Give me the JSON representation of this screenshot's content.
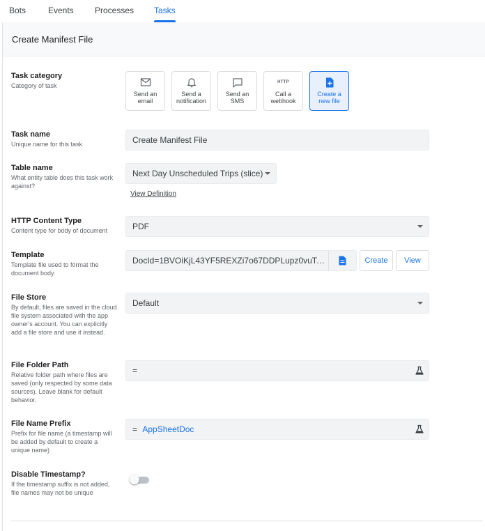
{
  "tabs": [
    {
      "label": "Bots"
    },
    {
      "label": "Events"
    },
    {
      "label": "Processes"
    },
    {
      "label": "Tasks"
    }
  ],
  "panel": {
    "title": "Create Manifest File"
  },
  "task_category": {
    "label": "Task category",
    "help": "Category of task",
    "options": [
      {
        "label": "Send an email",
        "icon": "email-icon"
      },
      {
        "label": "Send a notification",
        "icon": "bell-icon"
      },
      {
        "label": "Send an SMS",
        "icon": "chat-icon"
      },
      {
        "label": "Call a webhook",
        "icon": "http-icon",
        "icon_text": "HTTP"
      },
      {
        "label": "Create a new file",
        "icon": "new-file-icon"
      }
    ],
    "selected": "Create a new file"
  },
  "task_name": {
    "label": "Task name",
    "help": "Unique name for this task",
    "value": "Create Manifest File"
  },
  "table_name": {
    "label": "Table name",
    "help": "What entity table does this task work against?",
    "value": "Next Day Unscheduled Trips (slice)",
    "link": "View Definition"
  },
  "http_content_type": {
    "label": "HTTP Content Type",
    "help": "Content type for body of document",
    "value": "PDF"
  },
  "template": {
    "label": "Template",
    "help": "Template file used to format the document body.",
    "value": "DocId=1BVOiKjL43YF5REXZi7o67DDPLupz0vuTag...",
    "create_label": "Create",
    "view_label": "View"
  },
  "file_store": {
    "label": "File Store",
    "help": "By default, files are saved in the cloud file system associated with the app owner's account. You can explicitly add a file store and use it instead.",
    "value": "Default"
  },
  "file_folder_path": {
    "label": "File Folder Path",
    "help": "Relative folder path where files are saved (only respected by some data sources). Leave blank for default behavior.",
    "prefix": "="
  },
  "file_name_prefix": {
    "label": "File Name Prefix",
    "help": "Prefix for file name (a timestamp will be added by default to create a unique name)",
    "prefix": "=",
    "value": "AppSheetDoc"
  },
  "disable_timestamp": {
    "label": "Disable Timestamp?",
    "help": "If the timestamp suffix is not added, file names may not be unique",
    "enabled": false
  },
  "colors": {
    "accent": "#1a73e8",
    "field_bg": "#f1f3f4",
    "selected_bg": "#e8f0fe"
  }
}
